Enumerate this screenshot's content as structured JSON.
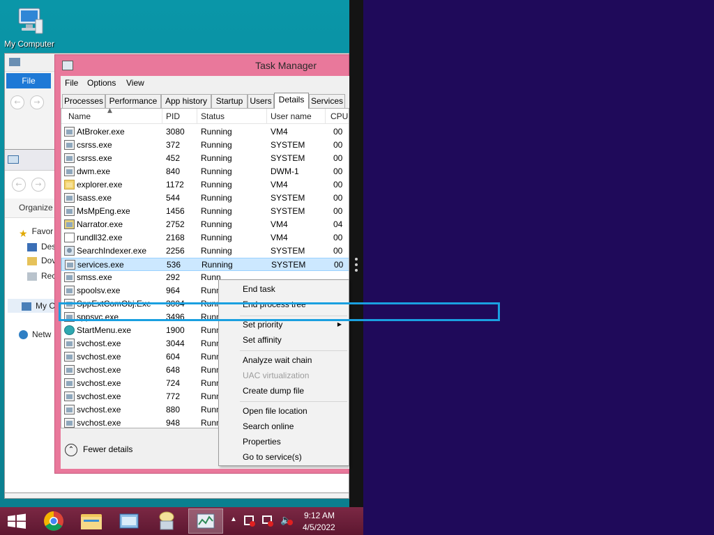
{
  "desktop": {
    "icon_label": "My Computer",
    "explorer1": {
      "file_tab": "File"
    },
    "explorer2": {
      "organize": "Organize",
      "nav_items": [
        "Favor",
        "Des",
        "Dov",
        "Rec",
        "My C",
        "Netw"
      ]
    }
  },
  "taskmgr": {
    "title": "Task Manager",
    "menu": [
      "File",
      "Options",
      "View"
    ],
    "tabs": [
      "Processes",
      "Performance",
      "App history",
      "Startup",
      "Users",
      "Details",
      "Services"
    ],
    "active_tab": "Details",
    "columns": [
      "Name",
      "PID",
      "Status",
      "User name",
      "CPU"
    ],
    "rows": [
      {
        "name": "AtBroker.exe",
        "pid": "3080",
        "status": "Running",
        "user": "VM4",
        "cpu": "00",
        "icon": "app"
      },
      {
        "name": "csrss.exe",
        "pid": "372",
        "status": "Running",
        "user": "SYSTEM",
        "cpu": "00",
        "icon": "app"
      },
      {
        "name": "csrss.exe",
        "pid": "452",
        "status": "Running",
        "user": "SYSTEM",
        "cpu": "00",
        "icon": "app"
      },
      {
        "name": "dwm.exe",
        "pid": "840",
        "status": "Running",
        "user": "DWM-1",
        "cpu": "00",
        "icon": "app"
      },
      {
        "name": "explorer.exe",
        "pid": "1172",
        "status": "Running",
        "user": "VM4",
        "cpu": "00",
        "icon": "folder"
      },
      {
        "name": "lsass.exe",
        "pid": "544",
        "status": "Running",
        "user": "SYSTEM",
        "cpu": "00",
        "icon": "app"
      },
      {
        "name": "MsMpEng.exe",
        "pid": "1456",
        "status": "Running",
        "user": "SYSTEM",
        "cpu": "00",
        "icon": "app"
      },
      {
        "name": "Narrator.exe",
        "pid": "2752",
        "status": "Running",
        "user": "VM4",
        "cpu": "04",
        "icon": "narr"
      },
      {
        "name": "rundll32.exe",
        "pid": "2168",
        "status": "Running",
        "user": "VM4",
        "cpu": "00",
        "icon": "doc"
      },
      {
        "name": "SearchIndexer.exe",
        "pid": "2256",
        "status": "Running",
        "user": "SYSTEM",
        "cpu": "00",
        "icon": "person"
      },
      {
        "name": "services.exe",
        "pid": "536",
        "status": "Running",
        "user": "SYSTEM",
        "cpu": "00",
        "icon": "app"
      },
      {
        "name": "smss.exe",
        "pid": "292",
        "status": "Runn",
        "user": "",
        "cpu": "",
        "icon": "app"
      },
      {
        "name": "spoolsv.exe",
        "pid": "964",
        "status": "Runn",
        "user": "",
        "cpu": "",
        "icon": "app"
      },
      {
        "name": "SppExtComObj.Exe",
        "pid": "3004",
        "status": "Runn",
        "user": "",
        "cpu": "",
        "icon": "app"
      },
      {
        "name": "sppsvc.exe",
        "pid": "3496",
        "status": "Runn",
        "user": "",
        "cpu": "",
        "icon": "app"
      },
      {
        "name": "StartMenu.exe",
        "pid": "1900",
        "status": "Runn",
        "user": "",
        "cpu": "",
        "icon": "globe"
      },
      {
        "name": "svchost.exe",
        "pid": "3044",
        "status": "Runn",
        "user": "",
        "cpu": "",
        "icon": "app"
      },
      {
        "name": "svchost.exe",
        "pid": "604",
        "status": "Runn",
        "user": "",
        "cpu": "",
        "icon": "app"
      },
      {
        "name": "svchost.exe",
        "pid": "648",
        "status": "Runn",
        "user": "",
        "cpu": "",
        "icon": "app"
      },
      {
        "name": "svchost.exe",
        "pid": "724",
        "status": "Runn",
        "user": "",
        "cpu": "",
        "icon": "app"
      },
      {
        "name": "svchost.exe",
        "pid": "772",
        "status": "Runn",
        "user": "",
        "cpu": "",
        "icon": "app"
      },
      {
        "name": "svchost.exe",
        "pid": "880",
        "status": "Runn",
        "user": "",
        "cpu": "",
        "icon": "app"
      },
      {
        "name": "svchost.exe",
        "pid": "948",
        "status": "Runn",
        "user": "",
        "cpu": "",
        "icon": "app"
      }
    ],
    "selected_row": "services.exe",
    "fewer_details": "Fewer details"
  },
  "context_menu": {
    "items": [
      {
        "label": "End task",
        "disabled": false
      },
      {
        "label": "End process tree",
        "disabled": false
      },
      {
        "label": "Set priority",
        "disabled": false,
        "submenu": true
      },
      {
        "label": "Set affinity",
        "disabled": false
      },
      {
        "label": "Analyze wait chain",
        "disabled": false
      },
      {
        "label": "UAC virtualization",
        "disabled": true
      },
      {
        "label": "Create dump file",
        "disabled": false
      },
      {
        "label": "Open file location",
        "disabled": false
      },
      {
        "label": "Search online",
        "disabled": false
      },
      {
        "label": "Properties",
        "disabled": false
      },
      {
        "label": "Go to service(s)",
        "disabled": false
      }
    ]
  },
  "taskbar": {
    "apps": [
      "start-button",
      "chrome-icon",
      "file-explorer-icon",
      "explorer-window-icon",
      "narrator-icon",
      "task-manager-icon"
    ],
    "time": "9:12 AM",
    "date": "4/5/2022"
  },
  "colors": {
    "taskmgr_frame": "#e9789b",
    "highlight": "#1aa0e0",
    "selection": "#cce8ff",
    "taskbar": "#6e1f3a",
    "start_screen": "#1f0a5a"
  }
}
